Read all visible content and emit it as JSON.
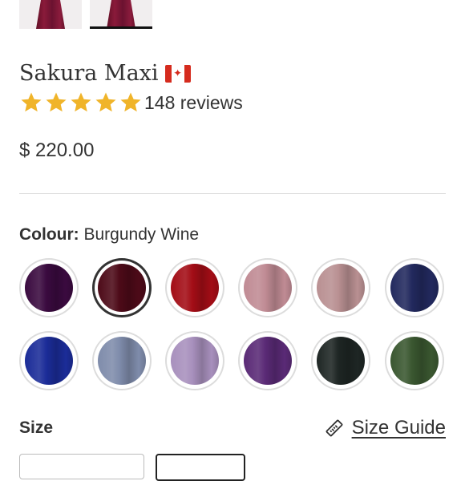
{
  "product": {
    "title": "Sakura Maxi",
    "flag_icon": "canada-flag-icon",
    "rating": 5,
    "reviews_text": "148 reviews",
    "price": "$ 220.00"
  },
  "colour": {
    "label": "Colour:",
    "selected_name": "Burgundy Wine",
    "swatches": [
      {
        "color": "#3a0a3f",
        "selected": false
      },
      {
        "color": "#4d0a18",
        "selected": true
      },
      {
        "color": "#a30d16",
        "selected": false
      },
      {
        "color": "#c08b94",
        "selected": false
      },
      {
        "color": "#b99092",
        "selected": false
      },
      {
        "color": "#22295e",
        "selected": false
      },
      {
        "color": "#1b2c98",
        "selected": false
      },
      {
        "color": "#7f8cab",
        "selected": false
      },
      {
        "color": "#a890bd",
        "selected": false
      },
      {
        "color": "#5a2a76",
        "selected": false
      },
      {
        "color": "#1e2624",
        "selected": false
      },
      {
        "color": "#3a5730",
        "selected": false
      }
    ]
  },
  "size": {
    "label": "Size",
    "guide_label": "Size Guide"
  },
  "colors": {
    "star": "#f0b429",
    "text": "#333333"
  }
}
